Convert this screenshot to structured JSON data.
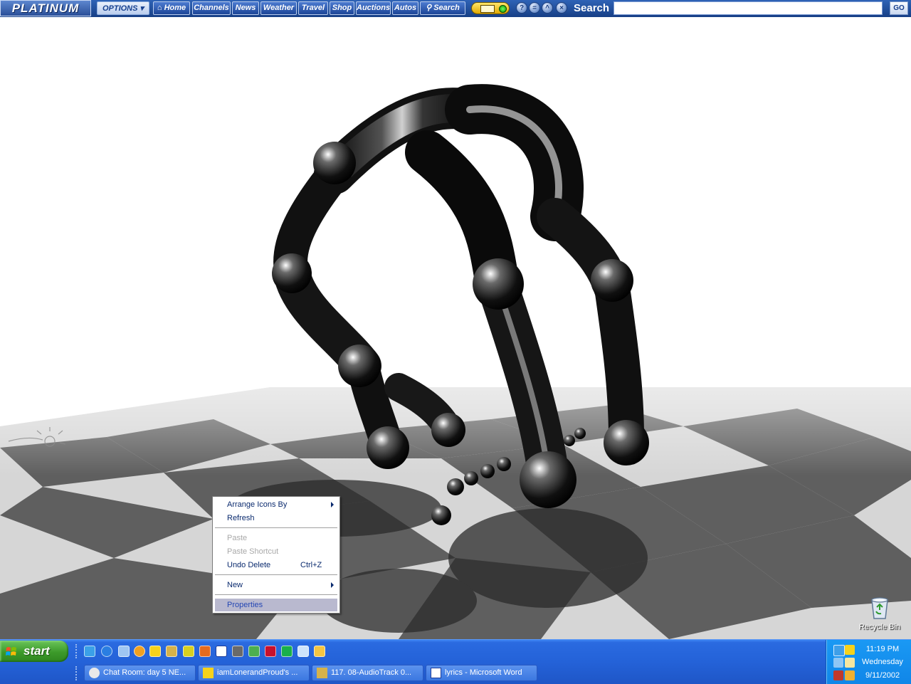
{
  "toolbar": {
    "brand": "PLATINUM",
    "options_label": "OPTIONS",
    "nav": [
      "Home",
      "Channels",
      "News",
      "Weather",
      "Travel",
      "Shop",
      "Auctions",
      "Autos",
      "Search"
    ],
    "help_glyph": "?",
    "minimize_glyph": "=",
    "maximize_glyph": "^",
    "close_glyph": "×",
    "search_label": "Search",
    "search_value": "",
    "go_label": "GO"
  },
  "context_menu": {
    "arrange": "Arrange Icons By",
    "refresh": "Refresh",
    "paste": "Paste",
    "paste_shortcut": "Paste Shortcut",
    "undo_delete": "Undo Delete",
    "undo_shortcut": "Ctrl+Z",
    "new": "New",
    "properties": "Properties"
  },
  "desktop": {
    "recycle_bin": "Recycle Bin"
  },
  "taskbar": {
    "start_label": "start",
    "quick_launch_icons": [
      "outlook-express-icon",
      "internet-explorer-icon",
      "windows-media-icon",
      "media-player-icon",
      "aim-icon",
      "winamp-icon",
      "messenger-icon",
      "powerpoint-icon",
      "word-icon",
      "network-icon",
      "download-icon",
      "acrobat-icon",
      "game-icon",
      "calculator-icon",
      "show-desktop-icon"
    ],
    "windows": [
      {
        "title": "Chat Room: day 5 NE...",
        "icon": "chat-icon"
      },
      {
        "title": "iamLonerandProud's ...",
        "icon": "aim-icon"
      },
      {
        "title": "117. 08-AudioTrack 0...",
        "icon": "winamp-icon"
      },
      {
        "title": "lyrics - Microsoft Word",
        "icon": "word-icon"
      }
    ],
    "clock": {
      "time": "11:19 PM",
      "day": "Wednesday",
      "date": "9/11/2002"
    }
  }
}
